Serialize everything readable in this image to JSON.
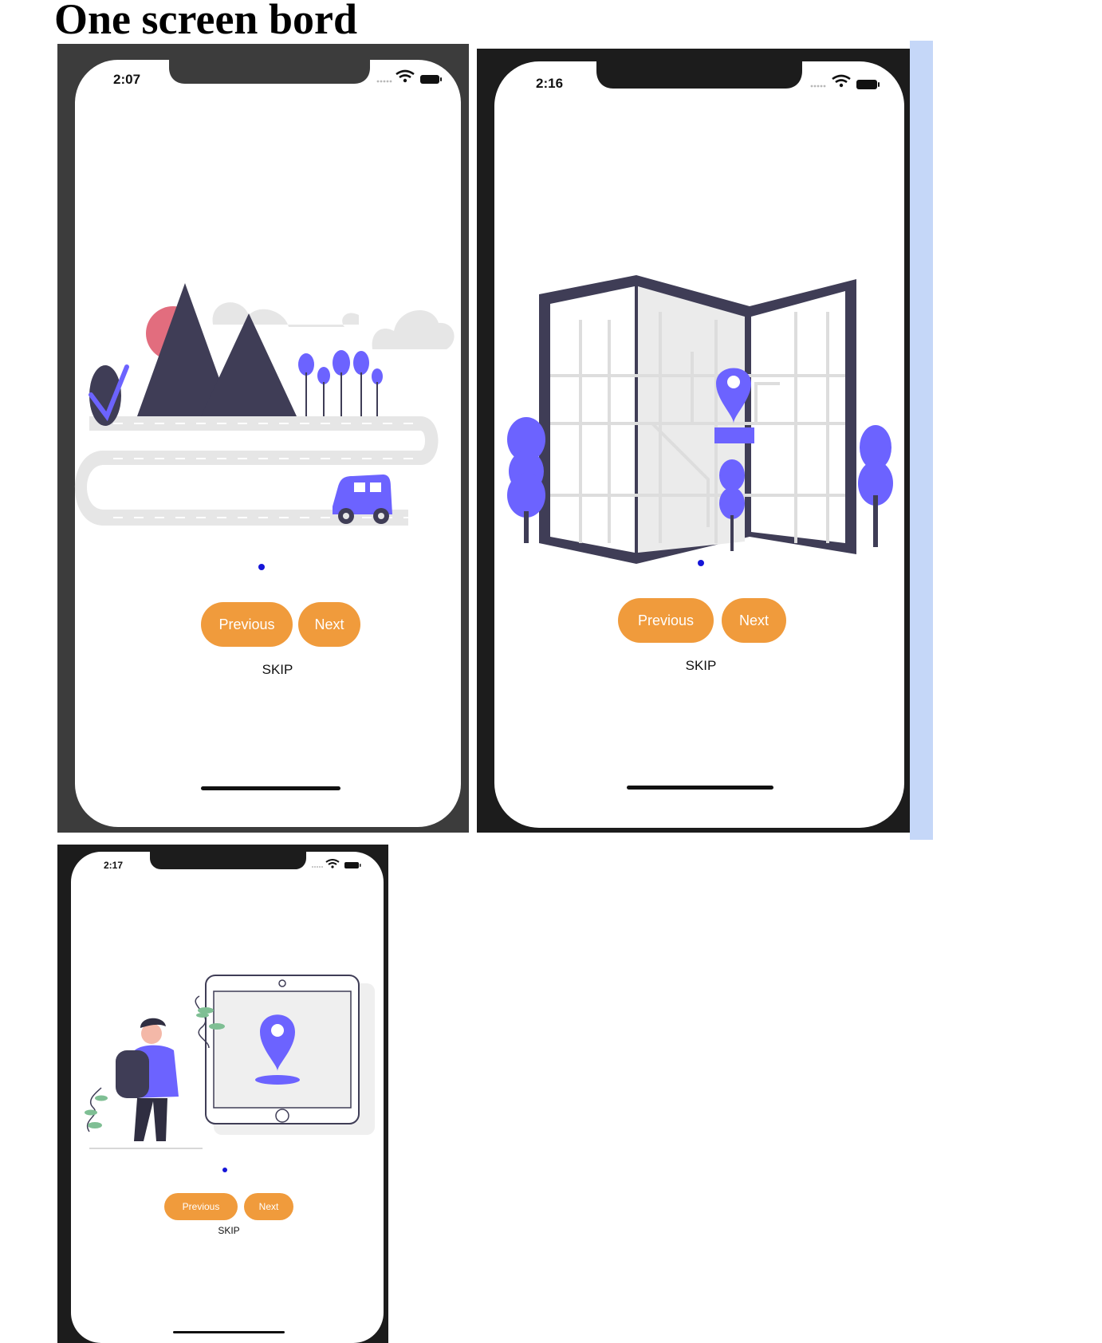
{
  "page": {
    "title": "One screen bord"
  },
  "screens": [
    {
      "time": "2:07",
      "illustration": "mountain-road-car-illustration",
      "buttons": {
        "previous": "Previous",
        "next": "Next"
      },
      "skip": "SKIP"
    },
    {
      "time": "2:16",
      "illustration": "folded-map-pin-illustration",
      "buttons": {
        "previous": "Previous",
        "next": "Next"
      },
      "skip": "SKIP"
    },
    {
      "time": "2:17",
      "illustration": "person-tablet-pin-illustration",
      "buttons": {
        "previous": "Previous",
        "next": "Next"
      },
      "skip": "SKIP"
    }
  ],
  "colors": {
    "button": "#f09b3c",
    "button_text": "#ffffff",
    "page_dot": "#1515d8",
    "accent": "#6c63ff",
    "dark_figure": "#3f3d56",
    "frame_dark": "#3c3c3c",
    "frame_black": "#1c1c1c",
    "side_strip": "#c5d7f8"
  }
}
